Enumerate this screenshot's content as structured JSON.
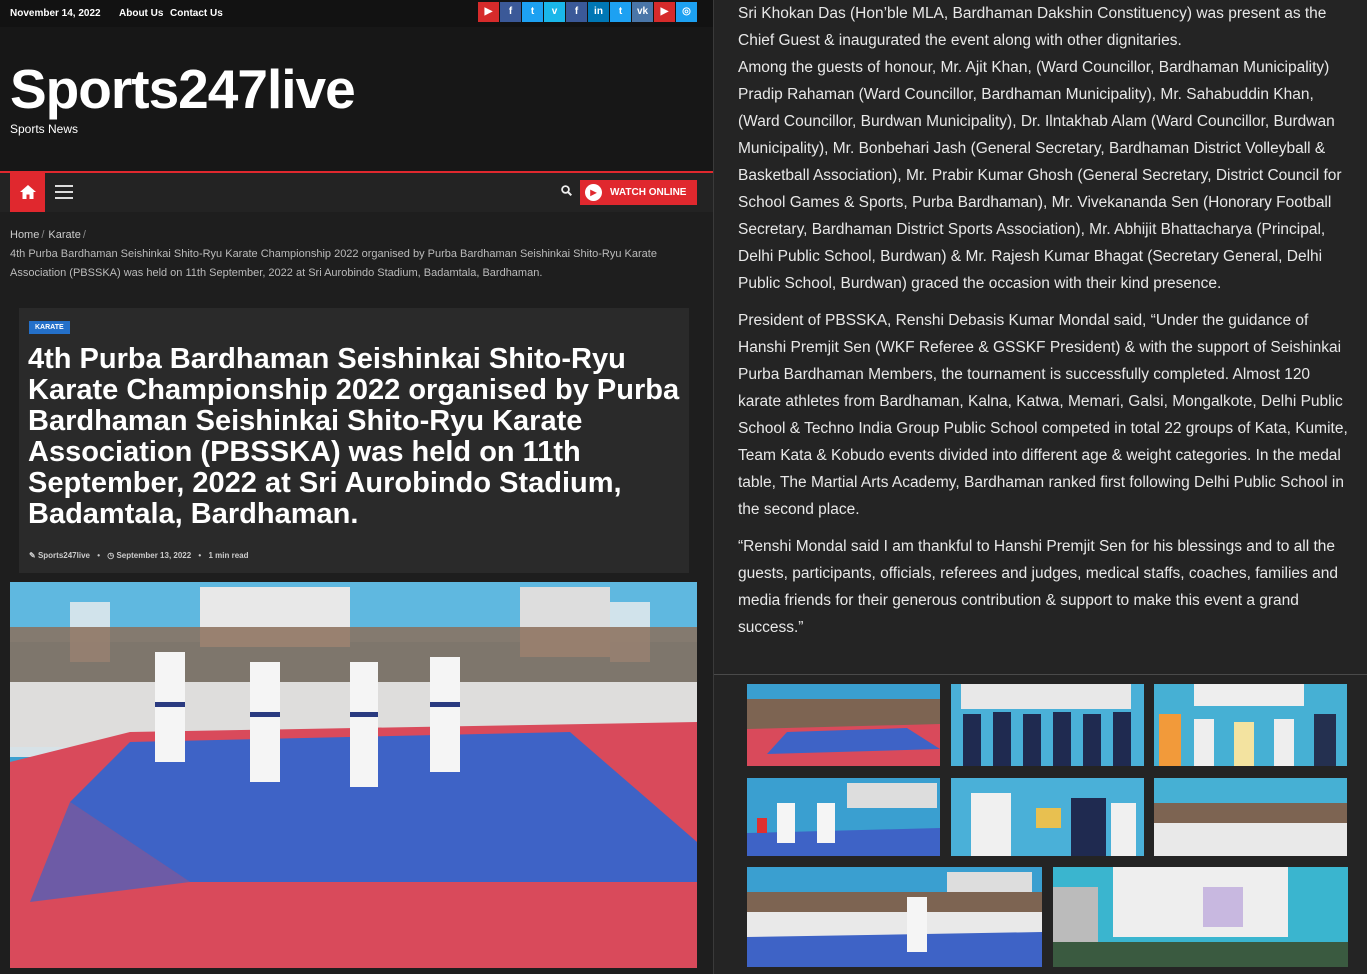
{
  "topbar": {
    "date": "November 14, 2022",
    "links": [
      "About Us",
      "Contact Us"
    ],
    "social": [
      {
        "icon": "youtube-icon",
        "glyph": "▶",
        "color": "#d62b2b"
      },
      {
        "icon": "facebook-icon",
        "glyph": "f",
        "color": "#3b5998"
      },
      {
        "icon": "twitter-icon",
        "glyph": "t",
        "color": "#1da1f2"
      },
      {
        "icon": "vimeo-icon",
        "glyph": "v",
        "color": "#1ab7ea"
      },
      {
        "icon": "facebook-icon",
        "glyph": "f",
        "color": "#3b5998"
      },
      {
        "icon": "linkedin-icon",
        "glyph": "in",
        "color": "#0077b5"
      },
      {
        "icon": "twitter-icon",
        "glyph": "t",
        "color": "#1da1f2"
      },
      {
        "icon": "vk-icon",
        "glyph": "vk",
        "color": "#4a76a8"
      },
      {
        "icon": "youtube-icon",
        "glyph": "▶",
        "color": "#d62b2b"
      },
      {
        "icon": "instagram-icon",
        "glyph": "◎",
        "color": "#1da1f2"
      }
    ]
  },
  "site": {
    "title": "Sports247live",
    "tagline": "Sports News"
  },
  "nav": {
    "watch_label": "WATCH ONLINE",
    "accent": "#e0282e"
  },
  "breadcrumb": {
    "home": "Home",
    "category": "Karate",
    "current": "4th Purba Bardhaman Seishinkai Shito-Ryu Karate Championship 2022 organised by Purba Bardhaman Seishinkai Shito-Ryu Karate Association (PBSSKA) was held on 11th September, 2022 at Sri Aurobindo Stadium, Badamtala, Bardhaman."
  },
  "article": {
    "category": "KARATE",
    "title": "4th Purba Bardhaman Seishinkai Shito-Ryu Karate Championship 2022 organised by Purba Bardhaman Seishinkai Shito-Ryu Karate Association (PBSSKA) was held on 11th September, 2022 at Sri Aurobindo Stadium, Badamtala, Bardhaman.",
    "author": "Sports247live",
    "date": "September 13, 2022",
    "read_time": "1 min read"
  },
  "body": {
    "paragraphs": [
      "Sri Khokan Das (Hon’ble MLA, Bardhaman Dakshin Constituency) was present as the Chief Guest & inaugurated the event along with other dignitaries.\nAmong the guests of honour, Mr. Ajit Khan, (Ward Councillor, Bardhaman Municipality) Pradip Rahaman (Ward Councillor, Bardhaman Municipality), Mr. Sahabuddin Khan, (Ward Councillor, Burdwan Municipality), Dr. Ilntakhab Alam (Ward Councillor, Burdwan Municipality), Mr. Bonbehari Jash (General Secretary, Bardhaman District Volleyball & Basketball Association), Mr. Prabir Kumar Ghosh (General Secretary, District Council for School Games & Sports, Purba Bardhaman), Mr. Vivekananda Sen (Honorary Football Secretary, Bardhaman District Sports Association), Mr. Abhijit Bhattacharya (Principal, Delhi Public School, Burdwan) & Mr. Rajesh Kumar Bhagat (Secretary General, Delhi Public School, Burdwan) graced the occasion with their kind presence.",
      "President of PBSSKA, Renshi Debasis Kumar Mondal said, “Under the guidance of Hanshi Premjit Sen (WKF Referee & GSSKF President) & with the support of Seishinkai Purba Bardhaman Members, the tournament is successfully completed. Almost 120 karate athletes from Bardhaman, Kalna, Katwa, Memari, Galsi, Mongalkote, Delhi Public School & Techno India Group Public School competed in total 22 groups of Kata, Kumite, Team Kata & Kobudo events divided into different age & weight categories. In the medal table, The Martial Arts Academy, Bardhaman ranked first following Delhi Public School in the second place.",
      "“Renshi Mondal said I am thankful to Hanshi Premjit Sen for his blessings and to all the guests, participants, officials, referees and judges, medical staffs, coaches, families and media friends for their generous contribution & support to make this event a grand success.”"
    ]
  }
}
